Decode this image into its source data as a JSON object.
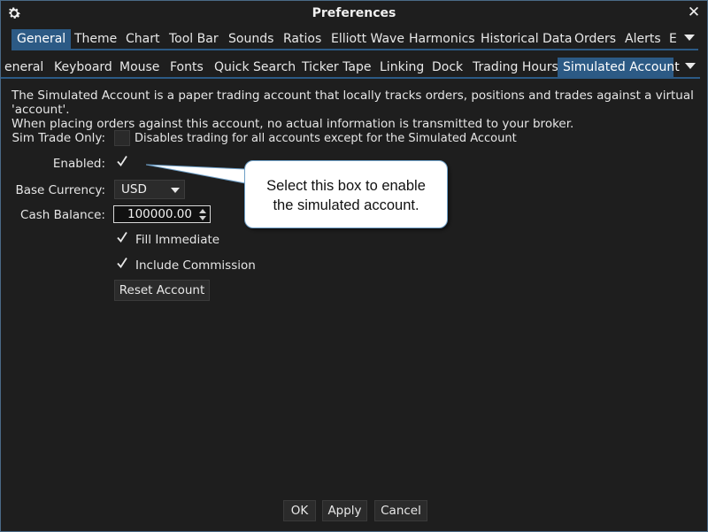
{
  "window": {
    "title": "Preferences"
  },
  "icons": {
    "settings": "gear-icon",
    "close": "close-icon"
  },
  "main_tabs": [
    {
      "label": "General",
      "active": true
    },
    {
      "label": "Theme"
    },
    {
      "label": "Chart"
    },
    {
      "label": "Tool Bar"
    },
    {
      "label": "Sounds"
    },
    {
      "label": "Ratios"
    },
    {
      "label": "Elliott Wave"
    },
    {
      "label": "Harmonics"
    },
    {
      "label": "Historical Data"
    },
    {
      "label": "Orders"
    },
    {
      "label": "Alerts"
    },
    {
      "label": "E"
    }
  ],
  "sub_tabs": [
    {
      "label": "eneral"
    },
    {
      "label": "Keyboard"
    },
    {
      "label": "Mouse"
    },
    {
      "label": "Fonts"
    },
    {
      "label": "Quick Search"
    },
    {
      "label": "Ticker Tape"
    },
    {
      "label": "Linking"
    },
    {
      "label": "Dock"
    },
    {
      "label": "Trading Hours"
    },
    {
      "label": "Simulated Account",
      "active": true
    }
  ],
  "description": {
    "line1": "The Simulated Account is a paper trading account that locally tracks orders, positions and trades against a virtual 'account'.",
    "line2": "When placing orders against this account, no actual information is transmitted to your broker."
  },
  "form": {
    "sim_trade_only": {
      "label": "Sim Trade Only:",
      "checked": false,
      "hint": "Disables trading for all accounts except for the Simulated Account"
    },
    "enabled": {
      "label": "Enabled:",
      "checked": true
    },
    "base_currency": {
      "label": "Base Currency:",
      "value": "USD"
    },
    "cash_balance": {
      "label": "Cash Balance:",
      "value": "100000.00"
    },
    "fill_immediate": {
      "label": "Fill Immediate",
      "checked": true
    },
    "include_commission": {
      "label": "Include Commission",
      "checked": true
    },
    "reset_account": {
      "label": "Reset Account"
    }
  },
  "callout": {
    "line1": "Select this box to enable",
    "line2": "the simulated account."
  },
  "footer": {
    "ok": "OK",
    "apply": "Apply",
    "cancel": "Cancel"
  },
  "colors": {
    "accent": "#2c5a85",
    "background": "#1e1e1e",
    "border": "#4a6a86"
  }
}
